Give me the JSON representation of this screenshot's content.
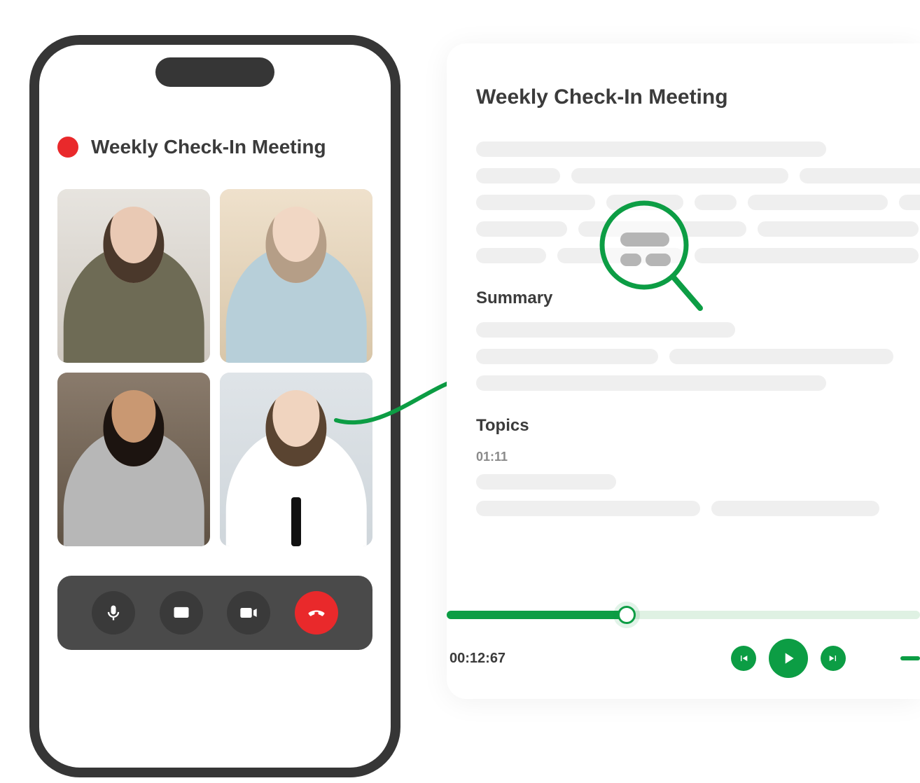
{
  "phone": {
    "title": "Weekly Check-In Meeting",
    "controls": {
      "mic": "microphone-icon",
      "screen": "screen-share-icon",
      "video": "video-icon",
      "end": "end-call-icon"
    }
  },
  "card": {
    "title": "Weekly Check-In Meeting",
    "summary_heading": "Summary",
    "topics_heading": "Topics",
    "topics_timestamp": "01:11"
  },
  "player": {
    "current_time": "00:12:67",
    "progress_percent": 38
  },
  "colors": {
    "accent": "#0c9d44",
    "recording": "#e9292b"
  }
}
